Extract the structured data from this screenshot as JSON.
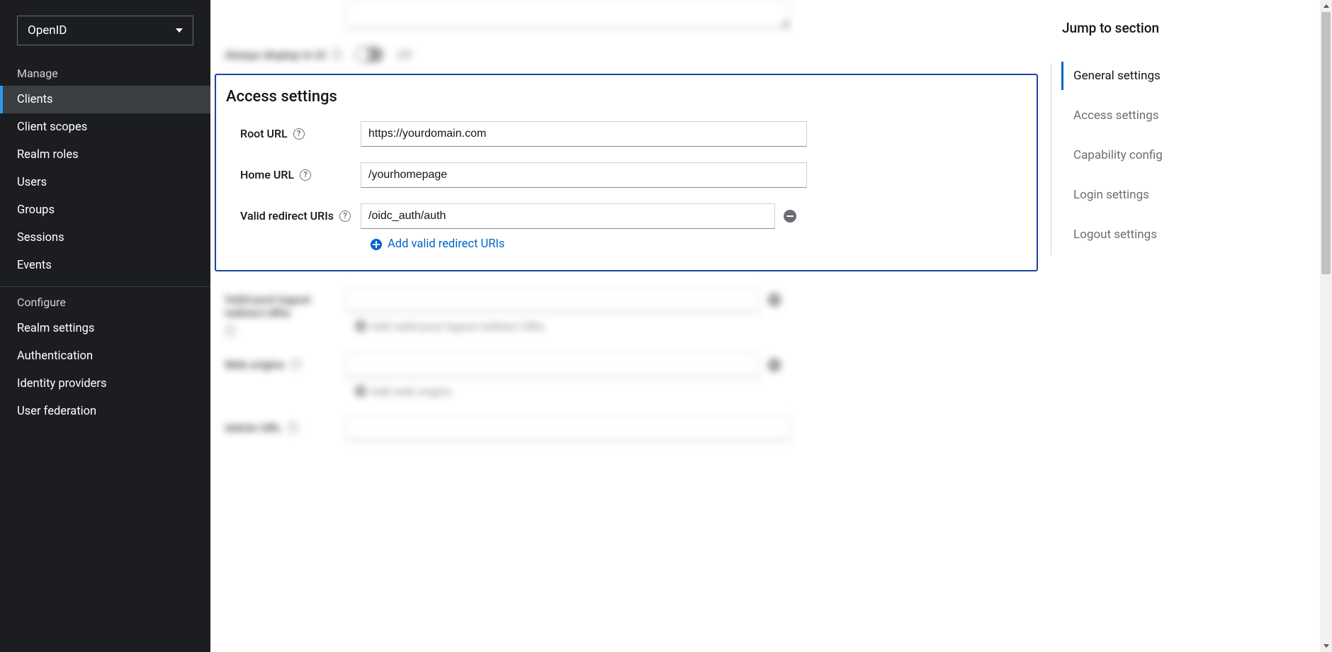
{
  "sidebar": {
    "realm": "OpenID",
    "sections": {
      "manage": {
        "title": "Manage",
        "items": [
          "Clients",
          "Client scopes",
          "Realm roles",
          "Users",
          "Groups",
          "Sessions",
          "Events"
        ]
      },
      "configure": {
        "title": "Configure",
        "items": [
          "Realm settings",
          "Authentication",
          "Identity providers",
          "User federation"
        ]
      }
    },
    "active_item": "Clients"
  },
  "blurred_above": {
    "always_display_label": "Always display in UI",
    "off": "Off"
  },
  "access_settings": {
    "title": "Access settings",
    "root_url": {
      "label": "Root URL",
      "value": "https://yourdomain.com"
    },
    "home_url": {
      "label": "Home URL",
      "value": "/yourhomepage"
    },
    "valid_redirect": {
      "label": "Valid redirect URIs",
      "value": "/oidc_auth/auth",
      "add_text": "Add valid redirect URIs"
    }
  },
  "blurred_below": {
    "post_logout": {
      "label": "Valid post logout redirect URIs",
      "add_text": "Add valid post logout redirect URIs"
    },
    "web_origins": {
      "label": "Web origins",
      "add_text": "Add web origins"
    },
    "admin_url": {
      "label": "Admin URL"
    }
  },
  "jump": {
    "title": "Jump to section",
    "links": [
      "General settings",
      "Access settings",
      "Capability config",
      "Login settings",
      "Logout settings"
    ],
    "active": "General settings"
  }
}
